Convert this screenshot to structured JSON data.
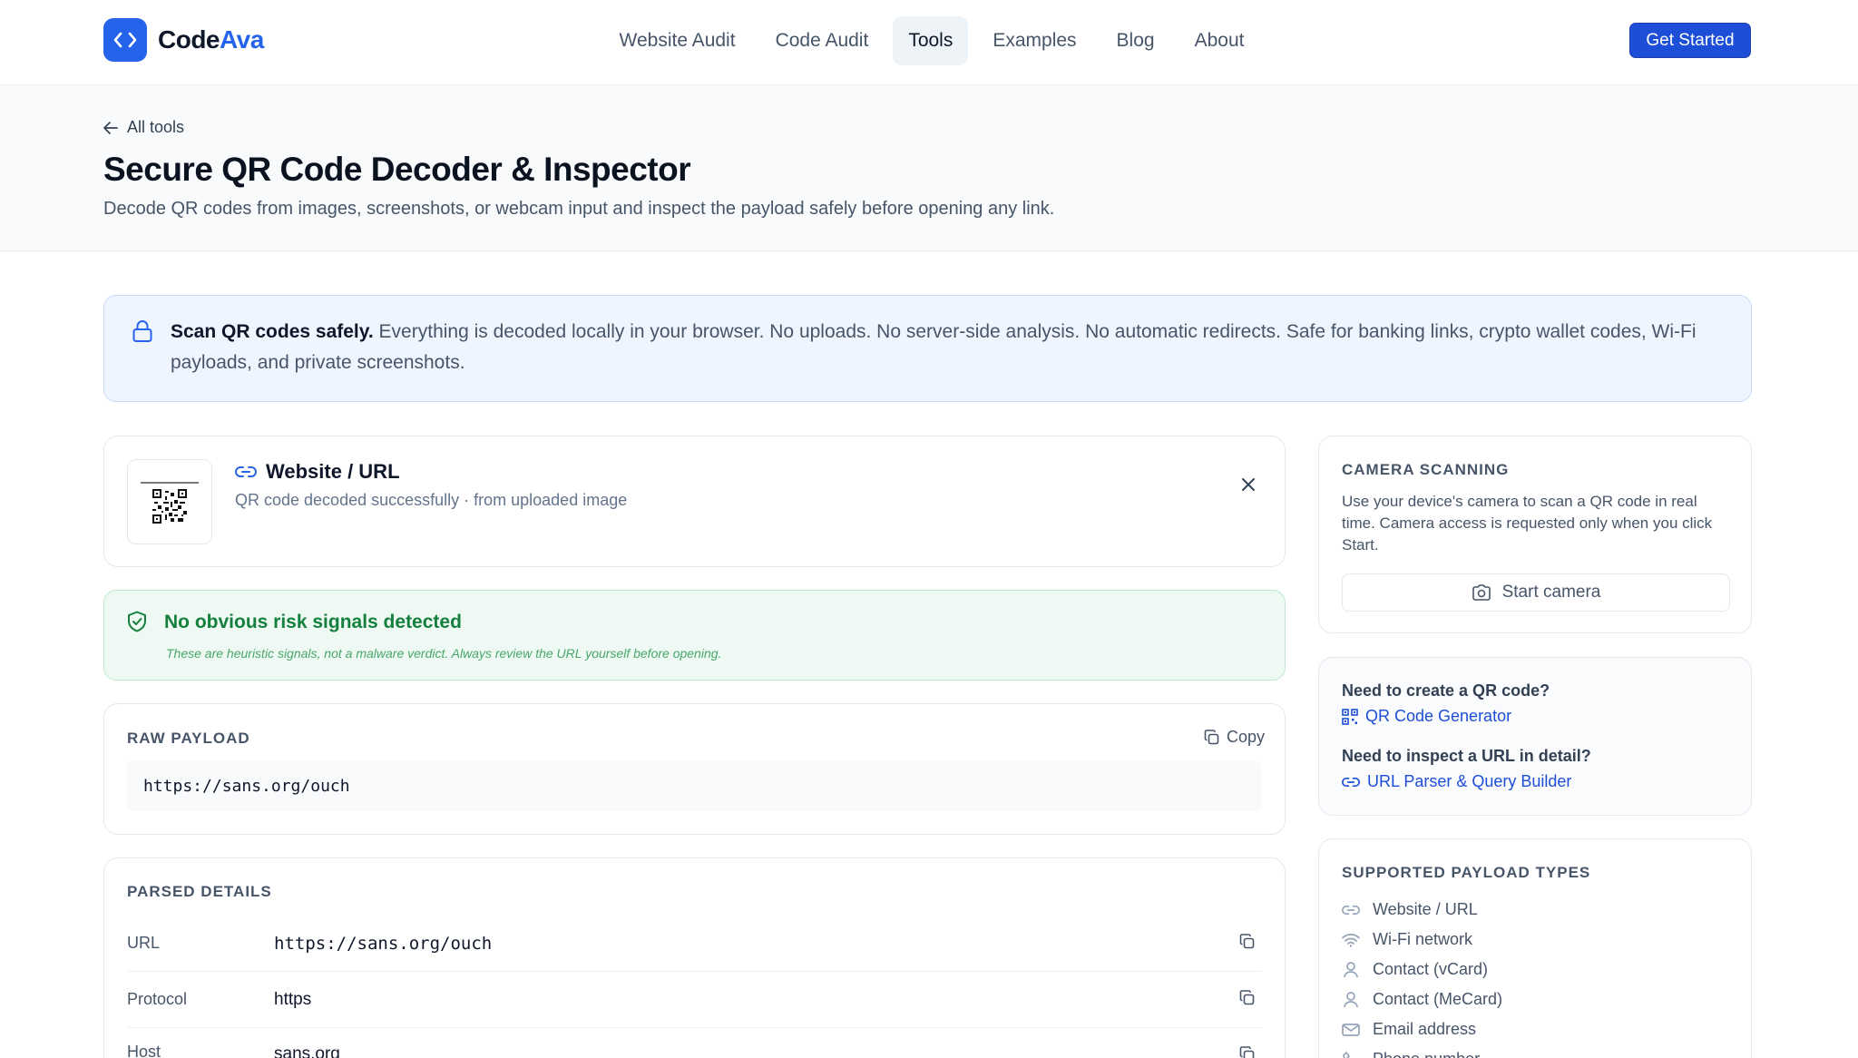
{
  "brand": {
    "name_part1": "Code",
    "name_part2": "Ava",
    "accent": "#2563eb"
  },
  "nav": {
    "items": [
      {
        "label": "Website Audit",
        "active": false
      },
      {
        "label": "Code Audit",
        "active": false
      },
      {
        "label": "Tools",
        "active": true
      },
      {
        "label": "Examples",
        "active": false
      },
      {
        "label": "Blog",
        "active": false
      },
      {
        "label": "About",
        "active": false
      }
    ],
    "cta_label": "Get Started"
  },
  "hero": {
    "back_label": "All tools",
    "title": "Secure QR Code Decoder & Inspector",
    "subtitle": "Decode QR codes from images, screenshots, or webcam input and inspect the payload safely before opening any link."
  },
  "notice": {
    "strong": "Scan QR codes safely.",
    "text": " Everything is decoded locally in your browser. No uploads. No server-side analysis. No automatic redirects. Safe for banking links, crypto wallet codes, Wi-Fi payloads, and private screenshots.",
    "icon": "lock-icon"
  },
  "result": {
    "type_label": "Website / URL",
    "status": "QR code decoded successfully · from uploaded image",
    "icon": "link-icon"
  },
  "risk": {
    "title": "No obvious risk signals detected",
    "note": "These are heuristic signals, not a malware verdict. Always review the URL yourself before opening.",
    "color": "#15803d"
  },
  "raw_payload": {
    "label": "RAW PAYLOAD",
    "copy_label": "Copy",
    "value": "https://sans.org/ouch"
  },
  "parsed": {
    "label": "PARSED DETAILS",
    "rows": [
      {
        "key": "URL",
        "value": "https://sans.org/ouch",
        "mono": true
      },
      {
        "key": "Protocol",
        "value": "https",
        "mono": false
      },
      {
        "key": "Host",
        "value": "sans.org",
        "mono": false
      }
    ]
  },
  "camera": {
    "label": "CAMERA SCANNING",
    "text": "Use your device's camera to scan a QR code in real time. Camera access is requested only when you click Start.",
    "button": "Start camera"
  },
  "related": {
    "q1": "Need to create a QR code?",
    "link1": "QR Code Generator",
    "q2": "Need to inspect a URL in detail?",
    "link2": "URL Parser & Query Builder"
  },
  "types": {
    "label": "SUPPORTED PAYLOAD TYPES",
    "items": [
      {
        "label": "Website / URL",
        "icon": "link-icon"
      },
      {
        "label": "Wi-Fi network",
        "icon": "wifi-icon"
      },
      {
        "label": "Contact (vCard)",
        "icon": "user-icon"
      },
      {
        "label": "Contact (MeCard)",
        "icon": "user-icon"
      },
      {
        "label": "Email address",
        "icon": "mail-icon"
      },
      {
        "label": "Phone number",
        "icon": "phone-icon"
      }
    ]
  }
}
